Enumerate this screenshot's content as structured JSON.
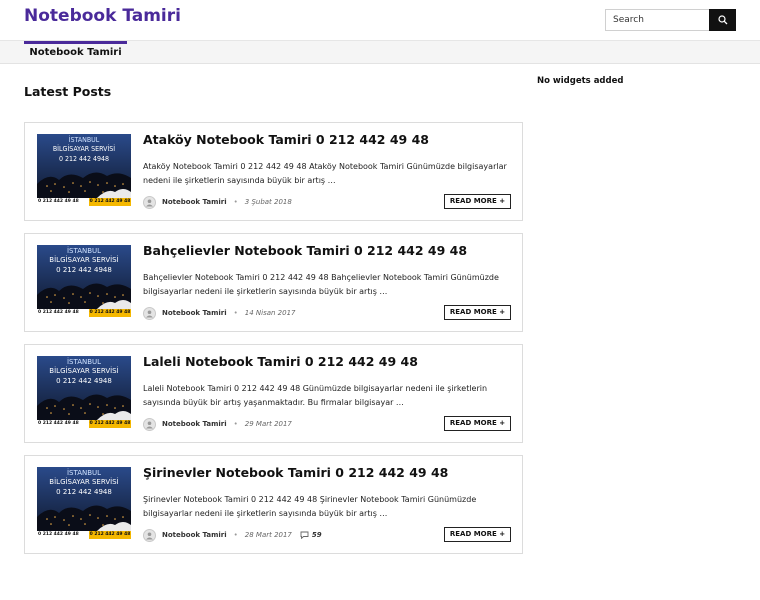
{
  "site": {
    "title": "Notebook Tamiri"
  },
  "search": {
    "placeholder": "Search"
  },
  "nav": {
    "items": [
      {
        "label": "Notebook Tamiri"
      }
    ]
  },
  "main": {
    "section_title": "Latest Posts"
  },
  "sidebar": {
    "widget_note": "No widgets added"
  },
  "thumbnail": {
    "line1": "İSTANBUL",
    "line2": "BİLGİSAYAR SERVİSİ",
    "line3": "0 212 442 4948",
    "footer_left": "0 212 442 49 48",
    "footer_right": "0 212 442 49 48"
  },
  "posts": [
    {
      "title": "Ataköy Notebook Tamiri 0 212 442 49 48",
      "excerpt": "Ataköy Notebook Tamiri 0 212 442 49 48 Ataköy Notebook Tamiri Günümüzde bilgisayarlar nedeni ile şirketlerin sayısında büyük bir artış …",
      "author": "Notebook Tamiri",
      "date": "3 Şubat 2018",
      "comments": "",
      "read_more": "READ MORE +"
    },
    {
      "title": "Bahçelievler Notebook Tamiri 0 212 442 49 48",
      "excerpt": "Bahçelievler Notebook Tamiri 0 212 442 49 48 Bahçelievler Notebook Tamiri Günümüzde bilgisayarlar nedeni ile şirketlerin sayısında büyük bir artış …",
      "author": "Notebook Tamiri",
      "date": "14 Nisan 2017",
      "comments": "",
      "read_more": "READ MORE +"
    },
    {
      "title": "Laleli Notebook Tamiri 0 212 442 49 48",
      "excerpt": "Laleli Notebook Tamiri 0 212 442 49 48 Günümüzde bilgisayarlar nedeni ile şirketlerin sayısında büyük bir artış yaşanmaktadır. Bu firmalar bilgisayar …",
      "author": "Notebook Tamiri",
      "date": "29 Mart 2017",
      "comments": "",
      "read_more": "READ MORE +"
    },
    {
      "title": "Şirinevler Notebook Tamiri 0 212 442 49 48",
      "excerpt": "Şirinevler Notebook Tamiri 0 212 442 49 48 Şirinevler Notebook Tamiri Günümüzde bilgisayarlar nedeni ile şirketlerin sayısında büyük bir artış …",
      "author": "Notebook Tamiri",
      "date": "28 Mart 2017",
      "comments": "59",
      "read_more": "READ MORE +"
    }
  ],
  "icons": {
    "search": "search-icon",
    "avatar": "user-avatar-icon",
    "comment": "comment-icon"
  },
  "colors": {
    "brand": "#4a2a9a",
    "search_button": "#111111",
    "nav_background": "#f5f5f5",
    "card_border": "#dcdcdc"
  }
}
